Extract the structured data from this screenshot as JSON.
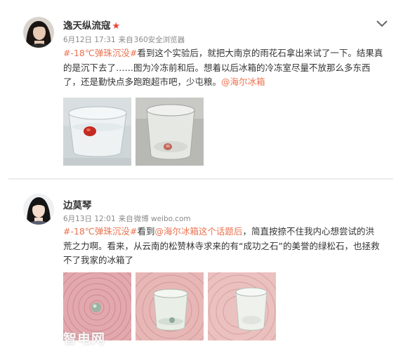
{
  "posts": [
    {
      "user": "逸天纵流寇",
      "date": "6月12日 17:31",
      "source_prefix": "来自",
      "source": "360安全浏览器",
      "lines": [
        [
          {
            "t": "tag",
            "v": "#-18℃弹珠沉没#"
          },
          {
            "t": "text",
            "v": "看到这个实验后，就把大南京的雨花石拿出来试了一下。结果真"
          }
        ],
        [
          {
            "t": "text",
            "v": "的是沉下去了……图为冷冻前和后。想着以后冰箱的冷冻室尽量不放那么多东西"
          }
        ],
        [
          {
            "t": "text",
            "v": "了，还是勤快点多跑跑超市吧，少屯粮。"
          },
          {
            "t": "mention",
            "v": "@海尔冰箱"
          }
        ]
      ]
    },
    {
      "user": "边莫琴",
      "date": "6月13日 12:01",
      "source_prefix": "来自",
      "source": "微博 weibo.com",
      "lines": [
        [
          {
            "t": "tag",
            "v": "#-18℃弹珠沉没#"
          },
          {
            "t": "text",
            "v": "看到"
          },
          {
            "t": "mention",
            "v": "@海尔冰箱这个话题后"
          },
          {
            "t": "text",
            "v": "，简直按捺不住我内心想尝试的洪"
          }
        ],
        [
          {
            "t": "text",
            "v": "荒之力啊。看来，从云南的松赞林寺求来的有“成功之石”的美誉的绿松石，也拯救"
          }
        ],
        [
          {
            "t": "text",
            "v": "不了我家的冰箱了"
          }
        ]
      ]
    }
  ],
  "watermark": "智电网",
  "icons": {
    "verified": "verified-star-icon",
    "menu": "chevron-down-icon"
  },
  "colors": {
    "link": "#eb7350",
    "star": "#eb3f2f",
    "meta": "#8a8a8a"
  }
}
